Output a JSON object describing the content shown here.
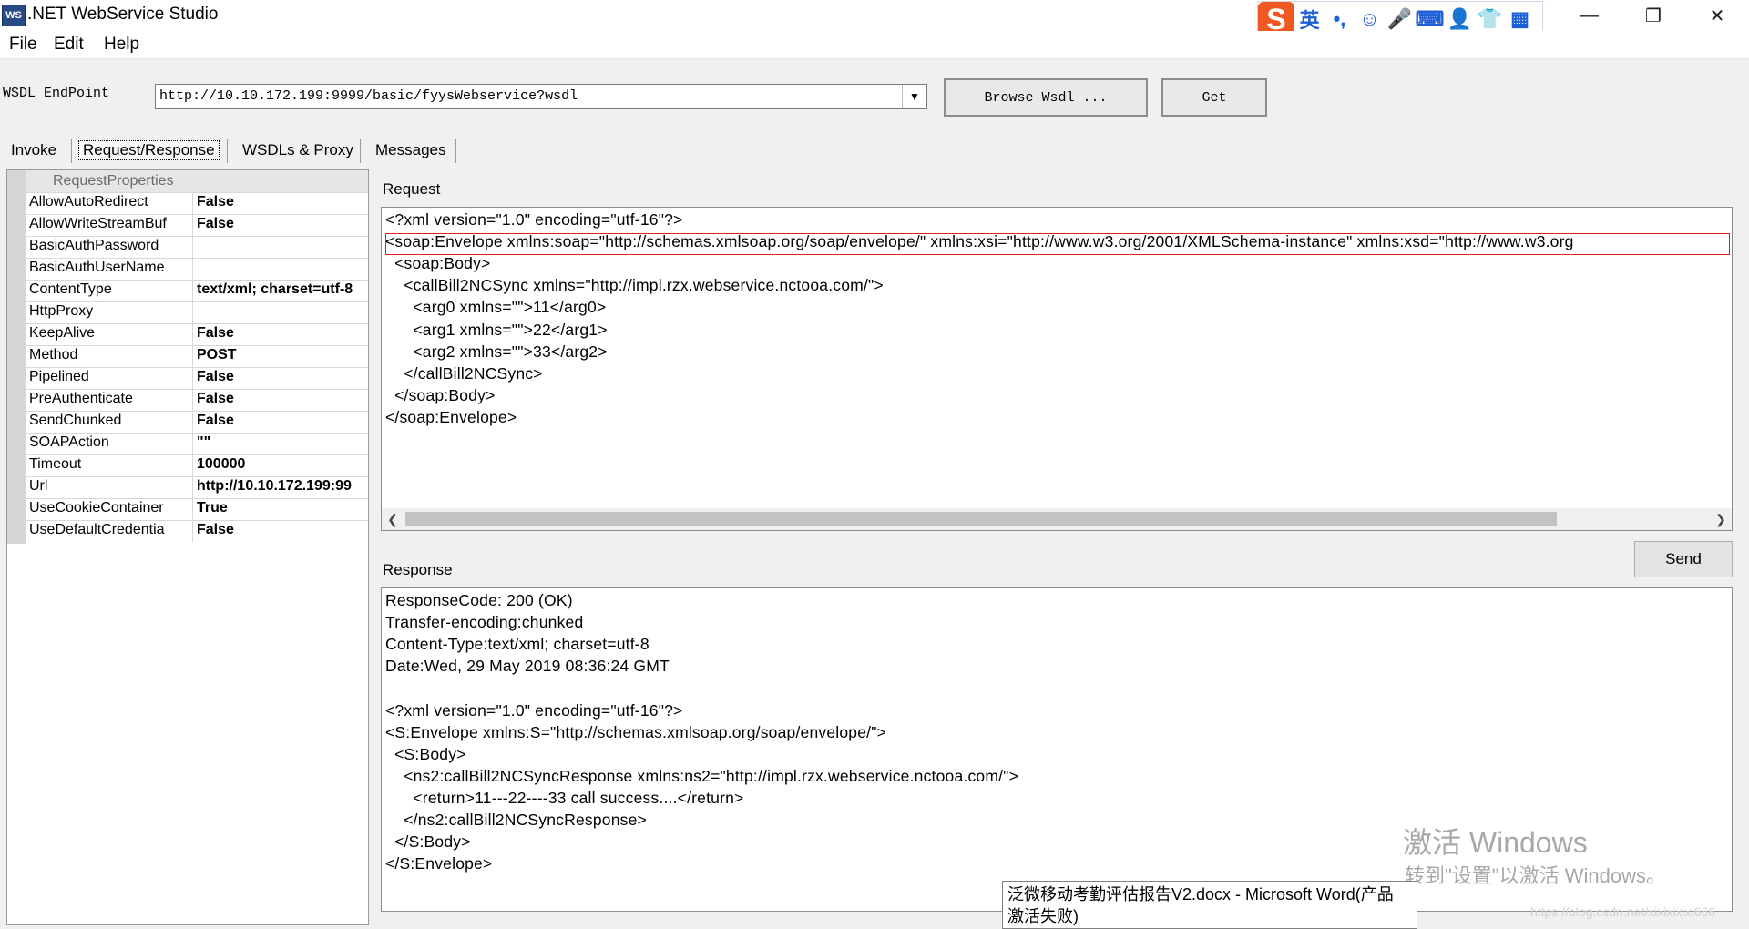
{
  "window": {
    "app_icon_text": "WS",
    "title": ".NET WebService Studio",
    "controls": {
      "minimize": "—",
      "restore": "❐",
      "close": "✕"
    }
  },
  "ime_toolbar": {
    "logo": "S",
    "items": [
      "英",
      "•,",
      "☺",
      "🎤",
      "⌨",
      "👤",
      "👕",
      "▦"
    ]
  },
  "menu": {
    "items": [
      "File",
      "Edit",
      "Help"
    ]
  },
  "endpoint": {
    "label": "WSDL EndPoint",
    "value": "http://10.10.172.199:9999/basic/fyysWebservice?wsdl",
    "browse_label": "Browse Wsdl ...",
    "get_label": "Get"
  },
  "tabs": [
    "Invoke",
    "Request/Response",
    "WSDLs & Proxy",
    "Messages"
  ],
  "active_tab": "Request/Response",
  "property_grid": {
    "category": "RequestProperties",
    "rows": [
      {
        "name": "AllowAutoRedirect",
        "value": "False"
      },
      {
        "name": "AllowWriteStreamBuf",
        "value": "False"
      },
      {
        "name": "BasicAuthPassword",
        "value": ""
      },
      {
        "name": "BasicAuthUserName",
        "value": ""
      },
      {
        "name": "ContentType",
        "value": "text/xml; charset=utf-8"
      },
      {
        "name": "HttpProxy",
        "value": ""
      },
      {
        "name": "KeepAlive",
        "value": "False"
      },
      {
        "name": "Method",
        "value": "POST"
      },
      {
        "name": "Pipelined",
        "value": "False"
      },
      {
        "name": "PreAuthenticate",
        "value": "False"
      },
      {
        "name": "SendChunked",
        "value": "False"
      },
      {
        "name": "SOAPAction",
        "value": "\"\""
      },
      {
        "name": "Timeout",
        "value": "100000"
      },
      {
        "name": "Url",
        "value": "http://10.10.172.199:99"
      },
      {
        "name": "UseCookieContainer",
        "value": "True"
      },
      {
        "name": "UseDefaultCredentia",
        "value": "False"
      }
    ]
  },
  "request": {
    "label": "Request",
    "lines": [
      "<?xml version=\"1.0\" encoding=\"utf-16\"?>",
      "<soap:Envelope xmlns:soap=\"http://schemas.xmlsoap.org/soap/envelope/\" xmlns:xsi=\"http://www.w3.org/2001/XMLSchema-instance\" xmlns:xsd=\"http://www.w3.org",
      "  <soap:Body>",
      "    <callBill2NCSync xmlns=\"http://impl.rzx.webservice.nctooa.com/\">",
      "      <arg0 xmlns=\"\">11</arg0>",
      "      <arg1 xmlns=\"\">22</arg1>",
      "      <arg2 xmlns=\"\">33</arg2>",
      "    </callBill2NCSync>",
      "  </soap:Body>",
      "</soap:Envelope>"
    ]
  },
  "send_label": "Send",
  "response": {
    "label": "Response",
    "lines": [
      "ResponseCode: 200 (OK)",
      "Transfer-encoding:chunked",
      "Content-Type:text/xml; charset=utf-8",
      "Date:Wed, 29 May 2019 08:36:24 GMT",
      "",
      "<?xml version=\"1.0\" encoding=\"utf-16\"?>",
      "<S:Envelope xmlns:S=\"http://schemas.xmlsoap.org/soap/envelope/\">",
      "  <S:Body>",
      "    <ns2:callBill2NCSyncResponse xmlns:ns2=\"http://impl.rzx.webservice.nctooa.com/\">",
      "      <return>11---22----33 call success....</return>",
      "    </ns2:callBill2NCSyncResponse>",
      "  </S:Body>",
      "</S:Envelope>"
    ]
  },
  "watermark": {
    "title": "激活 Windows",
    "subtitle": "转到\"设置\"以激活 Windows。",
    "site": "https://blog.csdn.net/xixixixixi666"
  },
  "tooltip": {
    "line1": "泛微移动考勤评估报告V2.docx - Microsoft Word(产品",
    "line2": "激活失败)"
  }
}
